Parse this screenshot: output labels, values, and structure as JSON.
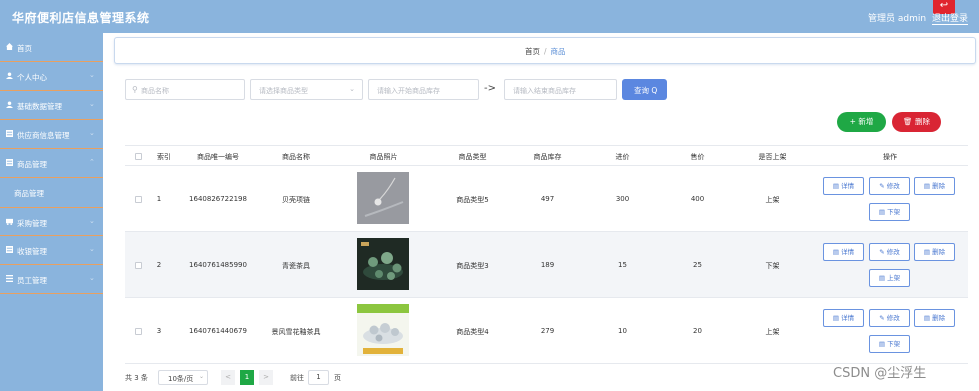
{
  "app": {
    "title": "华府便利店信息管理系统",
    "admin_label": "管理员 admin",
    "logout_label": "退出登录",
    "exit_icon": "exit-icon"
  },
  "sidebar": {
    "items": [
      {
        "label": "首页",
        "icon": "home-icon"
      },
      {
        "label": "个人中心",
        "icon": "user-icon"
      },
      {
        "label": "基础数据管理",
        "icon": "user-icon"
      },
      {
        "label": "供应商信息管理",
        "icon": "grid-icon"
      },
      {
        "label": "商品管理",
        "icon": "grid-icon"
      },
      {
        "label": "商品管理",
        "icon": ""
      },
      {
        "label": "采购管理",
        "icon": "cart-icon"
      },
      {
        "label": "收银管理",
        "icon": "grid-icon"
      },
      {
        "label": "员工管理",
        "icon": "menu-icon"
      }
    ]
  },
  "breadcrumb": {
    "home": "首页",
    "separator": "/",
    "current": "商品"
  },
  "search": {
    "name_placeholder": "商品名称",
    "type_placeholder": "请选择商品类型",
    "stock_start_placeholder": "请输入开始商品库存",
    "arrow": "->",
    "stock_end_placeholder": "请输入结束商品库存",
    "query_label": "查询 Q"
  },
  "actions": {
    "add_label": "+ 新增",
    "delete_label": "删除"
  },
  "table": {
    "headers": [
      "索引",
      "商品唯一编号",
      "商品名称",
      "商品照片",
      "商品类型",
      "商品库存",
      "进价",
      "售价",
      "是否上架",
      "操作"
    ],
    "rows": [
      {
        "index": "1",
        "code": "1640826722198",
        "name": "贝壳项链",
        "type": "商品类型5",
        "stock": "497",
        "cost": "300",
        "price": "400",
        "status": "上架",
        "photo": "gray-shell-necklace",
        "toggle_label": "下架"
      },
      {
        "index": "2",
        "code": "1640761485990",
        "name": "青瓷茶具",
        "type": "商品类型3",
        "stock": "189",
        "cost": "15",
        "price": "25",
        "status": "下架",
        "photo": "dark-green-tea-set",
        "toggle_label": "上架"
      },
      {
        "index": "3",
        "code": "1640761440679",
        "name": "景风雪花釉茶具",
        "type": "商品类型4",
        "stock": "279",
        "cost": "10",
        "price": "20",
        "status": "上架",
        "photo": "white-glass-tea-set",
        "toggle_label": "下架"
      }
    ],
    "row_actions": {
      "detail": "详情",
      "edit": "修改",
      "delete": "删除"
    }
  },
  "pagination": {
    "total": "共 3 条",
    "page_size": "10条/页",
    "prev": "<",
    "current_page": "1",
    "next": ">",
    "goto_label": "前往",
    "goto_value": "1",
    "goto_unit": "页"
  },
  "watermark": "CSDN @尘浮生",
  "colors": {
    "sidebar": "#8ab4dd",
    "accent": "#5b87e0",
    "add": "#1fa845",
    "delete": "#d92534"
  }
}
